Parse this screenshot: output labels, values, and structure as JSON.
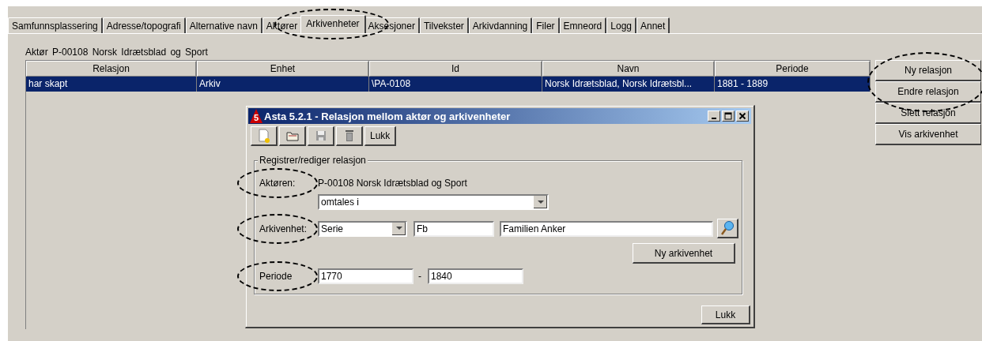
{
  "tabs": [
    {
      "label": "Samfunnsplassering",
      "selected": false,
      "circled": false
    },
    {
      "label": "Adresse/topografi",
      "selected": false,
      "circled": false
    },
    {
      "label": "Alternative navn",
      "selected": false,
      "circled": false
    },
    {
      "label": "Aktører",
      "selected": false,
      "circled": false
    },
    {
      "label": "Arkivenheter",
      "selected": true,
      "circled": true
    },
    {
      "label": "Aksesjoner",
      "selected": false,
      "circled": false
    },
    {
      "label": "Tilvekster",
      "selected": false,
      "circled": false
    },
    {
      "label": "Arkivdanning",
      "selected": false,
      "circled": false
    },
    {
      "label": "Filer",
      "selected": false,
      "circled": false
    },
    {
      "label": "Emneord",
      "selected": false,
      "circled": false
    },
    {
      "label": "Logg",
      "selected": false,
      "circled": false
    },
    {
      "label": "Annet",
      "selected": false,
      "circled": false
    }
  ],
  "actor_heading": "Aktør P-00108 Norsk Idrætsblad og Sport",
  "table": {
    "columns": [
      "Relasjon",
      "Enhet",
      "Id",
      "Navn",
      "Periode"
    ],
    "rows": [
      {
        "cells": [
          "har skapt",
          "Arkiv",
          "\\PA-0108",
          "Norsk Idrætsblad, Norsk Idrætsbl...",
          "1881 - 1889"
        ],
        "selected": true
      }
    ]
  },
  "side_buttons": [
    {
      "label": "Ny relasjon",
      "circled": true
    },
    {
      "label": "Endre relasjon",
      "circled": true
    },
    {
      "label": "Slett relasjon",
      "circled": false
    },
    {
      "label": "Vis arkivenhet",
      "circled": false
    }
  ],
  "dialog": {
    "icon_label": "5",
    "title": "Asta 5.2.1 - Relasjon mellom aktør og arkivenheter",
    "toolbar": [
      {
        "kind": "new"
      },
      {
        "kind": "open"
      },
      {
        "kind": "save"
      },
      {
        "kind": "delete"
      },
      {
        "kind": "text",
        "label": "Lukk"
      }
    ],
    "group_title": "Registrer/rediger relasjon",
    "actor": {
      "label": "Aktøren:",
      "circled": true,
      "value": "P-00108 Norsk Idrætsblad og Sport"
    },
    "relation_select": {
      "value": "omtales i"
    },
    "unit": {
      "label": "Arkivenhet:",
      "circled": true,
      "type_value": "Serie",
      "code_value": "Fb",
      "name_value": "Familien Anker"
    },
    "new_unit_button": "Ny arkivenhet",
    "period": {
      "label": "Periode",
      "circled": true,
      "from": "1770",
      "separator": "-",
      "to": "1840"
    },
    "close_button": "Lukk"
  }
}
